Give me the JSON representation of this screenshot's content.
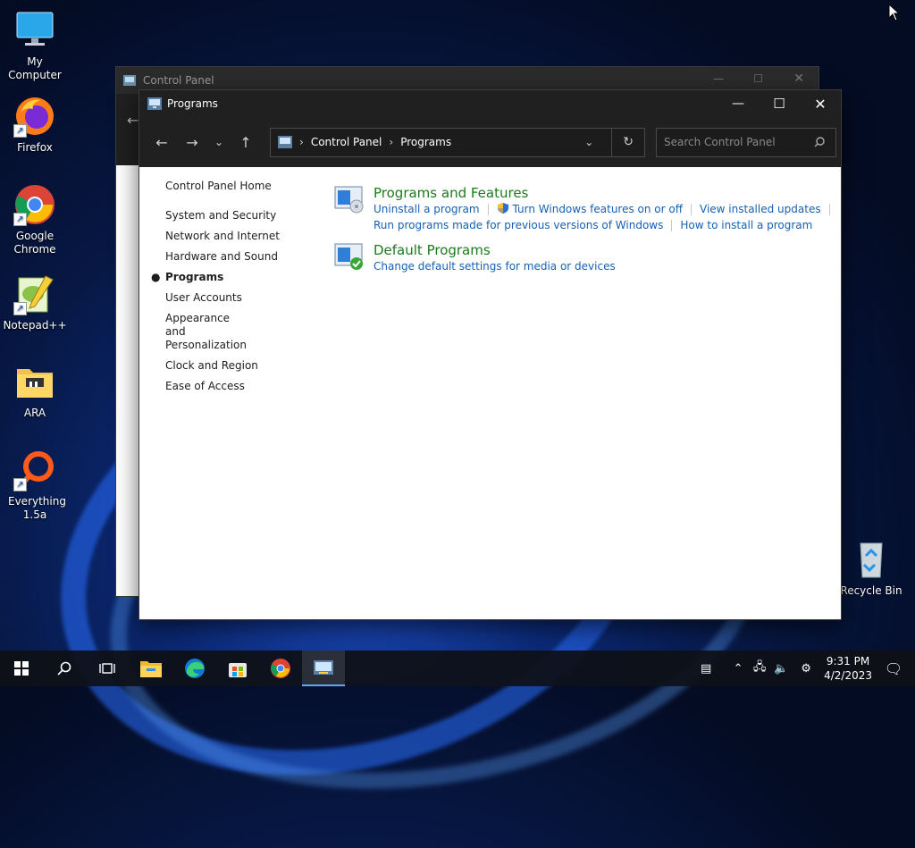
{
  "desktop": {
    "icons": [
      {
        "label": "My Computer"
      },
      {
        "label": "Firefox"
      },
      {
        "label": "Google Chrome"
      },
      {
        "label": "Notepad++"
      },
      {
        "label": "ARA"
      },
      {
        "label": "Everything 1.5a"
      },
      {
        "label": "Recycle Bin"
      }
    ]
  },
  "back_window": {
    "title": "Control Panel"
  },
  "window": {
    "title": "Programs",
    "breadcrumb": [
      "Control Panel",
      "Programs"
    ],
    "search_placeholder": "Search Control Panel",
    "left_nav": {
      "home": "Control Panel Home",
      "items": [
        {
          "label": "System and Security",
          "active": false
        },
        {
          "label": "Network and Internet",
          "active": false
        },
        {
          "label": "Hardware and Sound",
          "active": false
        },
        {
          "label": "Programs",
          "active": true
        },
        {
          "label": "User Accounts",
          "active": false
        },
        {
          "label": "Appearance and Personalization",
          "active": false
        },
        {
          "label": "Clock and Region",
          "active": false
        },
        {
          "label": "Ease of Access",
          "active": false
        }
      ]
    },
    "categories": [
      {
        "title": "Programs and Features",
        "links": [
          "Uninstall a program",
          "Turn Windows features on or off",
          "View installed updates",
          "Run programs made for previous versions of Windows",
          "How to install a program"
        ]
      },
      {
        "title": "Default Programs",
        "links": [
          "Change default settings for media or devices"
        ]
      }
    ]
  },
  "taskbar": {
    "clock_time": "9:31 PM",
    "clock_date": "4/2/2023"
  },
  "colors": {
    "link": "#1660b4",
    "category_title": "#1d7a1d",
    "titlebar": "#202020"
  }
}
